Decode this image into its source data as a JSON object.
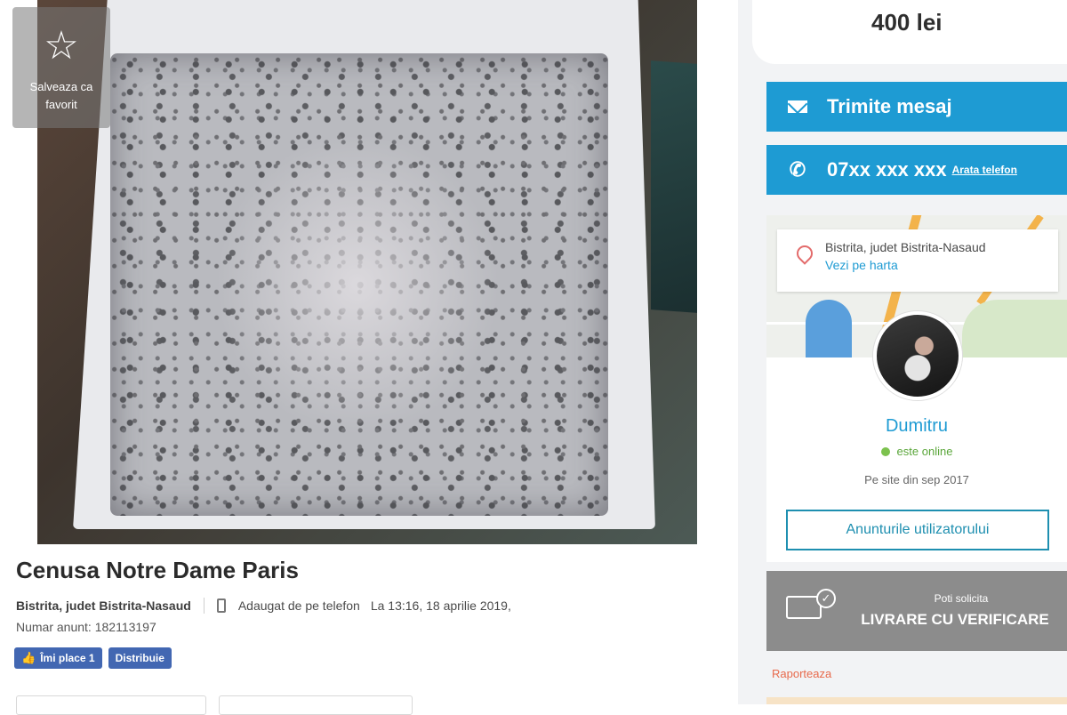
{
  "favorite": {
    "label": "Salveaza ca favorit",
    "icon": "star-icon"
  },
  "listing": {
    "title": "Cenusa Notre Dame Paris",
    "location": "Bistrita, judet Bistrita-Nasaud",
    "added_via": "Adaugat de pe telefon",
    "date": "La 13:16, 18 aprilie 2019,",
    "ad_number": "Numar anunt: 182113197"
  },
  "social": {
    "like_label": "Îmi place 1",
    "share_label": "Distribuie"
  },
  "sidebar": {
    "price": "400 lei",
    "message_button": "Trimite mesaj",
    "phone_masked": "07xx xxx xxx",
    "show_phone": "Arata telefon",
    "map_location": "Bistrita, judet Bistrita-Nasaud",
    "map_link": "Vezi pe harta",
    "seller_name": "Dumitru",
    "seller_status": "este online",
    "seller_since": "Pe site din sep 2017",
    "seller_ads_button": "Anunturile utilizatorului",
    "delivery_line1": "Poti solicita",
    "delivery_line2": "LIVRARE CU VERIFICARE",
    "report": "Raporteaza"
  },
  "colors": {
    "accent": "#1e9bd3",
    "facebook": "#4267b2",
    "delivery_bg": "#8c8c8c",
    "report": "#e86a4c"
  }
}
